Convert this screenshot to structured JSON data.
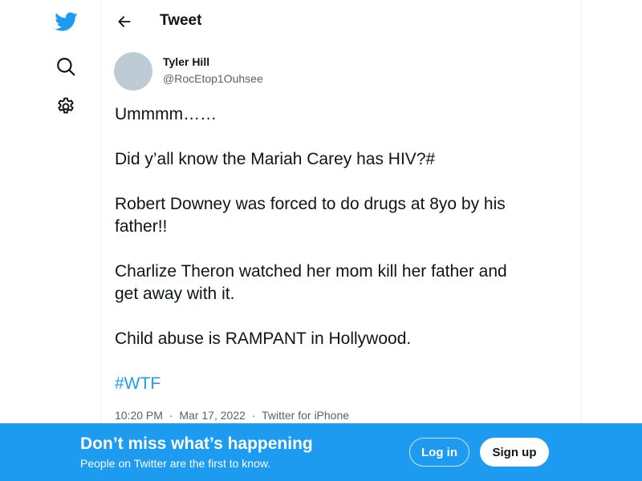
{
  "nav": {
    "logo_icon": "twitter-bird-icon",
    "explore_icon": "search-icon",
    "settings_icon": "gear-icon"
  },
  "header": {
    "back_icon": "arrow-left-icon",
    "title": "Tweet"
  },
  "tweet": {
    "author_name": "Tyler Hill",
    "author_handle": "@RocEtop1Ouhsee",
    "lines": [
      "Ummmm……",
      "Did y’all know the Mariah Carey has HIV?#",
      "Robert Downey was forced to do drugs at 8yo by his",
      "father!!",
      "Charlize Theron watched her mom kill her father and",
      "get away with it.",
      "Child abuse is RAMPANT in Hollywood."
    ],
    "hashtag": "#WTF",
    "time": "10:20 PM",
    "date": "Mar 17, 2022",
    "source": "Twitter for iPhone",
    "separator": "·"
  },
  "banner": {
    "title": "Don’t miss what’s happening",
    "subtitle": "People on Twitter are the first to know.",
    "login_label": "Log in",
    "signup_label": "Sign up"
  },
  "colors": {
    "brand": "#1d9bf0",
    "text": "#0f1419",
    "muted": "#536471",
    "avatar": "#bccbd4"
  }
}
